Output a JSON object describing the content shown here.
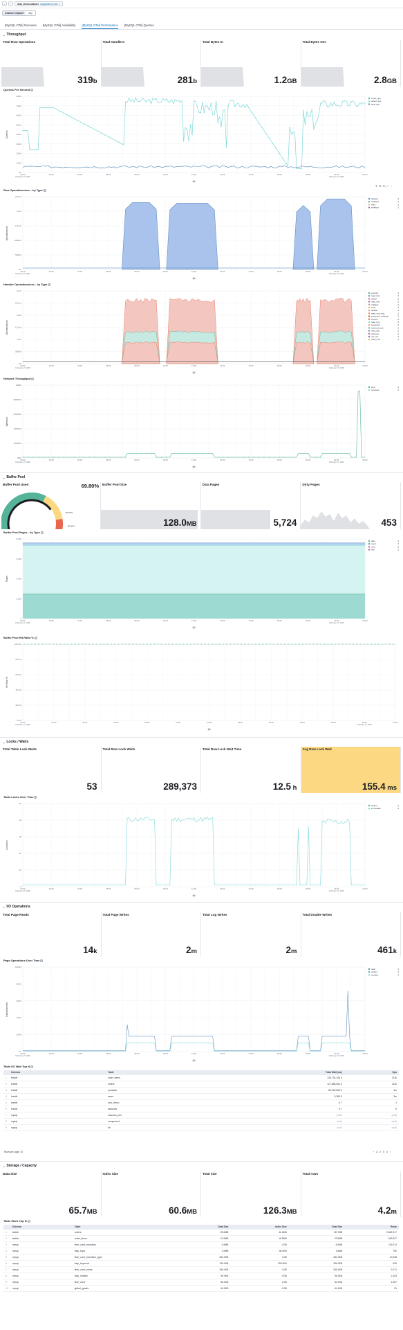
{
  "header": {
    "filter_key": "data_stream.dataset",
    "filter_val": "mysqlobserve.otel"
  },
  "filter": {
    "label": "instance.endpoint",
    "value": "Any"
  },
  "tabs": [
    "[MySQL OTel] Overview",
    "[MySQL OTel] Availability",
    "[MySQL OTel] Performance",
    "[MySQL OTel] Queries"
  ],
  "sections": {
    "throughput": "Throughput",
    "buffer": "Buffer Pool",
    "locks": "Locks / Waits",
    "io": "I/O Operations",
    "storage": "Storage / Capacity"
  },
  "throughput_tiles": [
    {
      "title": "Total Row Operations",
      "value": "319",
      "unit": "b"
    },
    {
      "title": "Total Handlers",
      "value": "281",
      "unit": "b"
    },
    {
      "title": "Total Bytes In",
      "value": "1.2",
      "unit": "GB"
    },
    {
      "title": "Total Bytes Out",
      "value": "2.8",
      "unit": "GB"
    }
  ],
  "panels": {
    "qps": {
      "title": "Queries Per Second",
      "ylabel": "Queries",
      "xlabel": "@t",
      "legend": [
        "insert_qps",
        "select_qps",
        "total_qps"
      ]
    },
    "rowops": {
      "title": "Row Operations/sec - by Type",
      "ylabel": "Operations/sec",
      "xlabel": "@t",
      "legend": [
        "deleted",
        "updated",
        "read",
        "inserted"
      ],
      "legend_vals": [
        "2",
        "2",
        "2",
        "2"
      ]
    },
    "handler": {
      "title": "Handler Operations/sec - by Type",
      "ylabel": "Operations/sec",
      "xlabel": "@t",
      "legend": [
        "prepare",
        "read_first",
        "delete",
        "read_first",
        "rollback",
        "write",
        "update",
        "read_rnd_next",
        "savepoint_rollback",
        "commit",
        "read_key",
        "savepoint",
        "external_lock",
        "read_last",
        "discover",
        "mrr_init",
        "read_next"
      ],
      "legend_vals": [
        "2",
        "2",
        "2",
        "2",
        "2",
        "2",
        "2",
        "2",
        "2",
        "2",
        "2",
        "2",
        "2",
        "2",
        "2",
        "2",
        "2"
      ]
    },
    "network": {
      "title": "Network Throughput",
      "ylabel": "Bytes/sec",
      "xlabel": "@t",
      "legend": [
        "sent",
        "received"
      ],
      "legend_vals": [
        "2",
        "2"
      ]
    },
    "bufpages": {
      "title": "Buffer Pool Pages - by Type",
      "ylabel": "Pages",
      "xlabel": "@t",
      "legend": [
        "data",
        "used",
        "misc",
        "free"
      ],
      "legend_vals": [
        "2",
        "2",
        "2",
        "2"
      ]
    },
    "hitratio": {
      "title": "Buffer Pool Hit Ratio %",
      "ylabel": "Hit Ratio %",
      "xlabel": "@t"
    },
    "tablelocks": {
      "title": "Table Locks Over Time",
      "ylabel": "Locks/sec",
      "xlabel": "@t",
      "legend": [
        "waited",
        "immediate"
      ],
      "legend_vals": [
        "2",
        "2"
      ]
    },
    "pageops": {
      "title": "Page Operations Over Time",
      "ylabel": "Operations/sec",
      "xlabel": "@t",
      "legend": [
        "read",
        "written",
        "created"
      ],
      "legend_vals": [
        "2",
        "2",
        "2"
      ]
    }
  },
  "date_label": "February 17, 2026",
  "buffer": {
    "gauge_title": "Buffer Pool Used",
    "gauge_value": "69.80%",
    "gauge_ticks": [
      "80.00%",
      "90.00%",
      "100.00%"
    ],
    "tiles": [
      {
        "title": "Buffer Pool Size",
        "value": "128.0",
        "unit": "MB"
      },
      {
        "title": "Data Pages",
        "value": "5,724",
        "unit": ""
      },
      {
        "title": "Dirty Pages",
        "value": "453",
        "unit": ""
      }
    ]
  },
  "locks_tiles": [
    {
      "title": "Total Table Lock Waits",
      "value": "53",
      "unit": ""
    },
    {
      "title": "Total Row Lock Waits",
      "value": "289,373",
      "unit": ""
    },
    {
      "title": "Total Row Lock Wait Time",
      "value": "12.5",
      "unit": " h"
    },
    {
      "title": "Avg Row Lock Wait",
      "value": "155.4",
      "unit": " ms"
    }
  ],
  "io_tiles": [
    {
      "title": "Total Page Reads",
      "value": "14",
      "unit": "k"
    },
    {
      "title": "Total Page Writes",
      "value": "2",
      "unit": "m"
    },
    {
      "title": "Total Log Writes",
      "value": "2",
      "unit": "m"
    },
    {
      "title": "Total Double Writes",
      "value": "461",
      "unit": "k"
    }
  ],
  "io_table": {
    "title": "Table I/O Wait Top N",
    "headers": [
      "Schema",
      "Table",
      "Total Wait (ms)",
      "Ops"
    ],
    "rows": [
      [
        "testdb",
        "order_items",
        "136,734,106.3",
        "113k"
      ],
      [
        "testdb",
        "orders",
        "127,868,561.4",
        "113k"
      ],
      [
        "testdb",
        "products",
        "65,220,803.0",
        "4m"
      ],
      [
        "testdb",
        "users",
        "5,383.9",
        "3m"
      ],
      [
        "testdb",
        "lock_demo",
        "0.7",
        "1"
      ],
      [
        "testdb",
        "sessions",
        "0.7",
        "9"
      ],
      [
        "mysql",
        "columns_priv",
        "(null)",
        "(null)"
      ],
      [
        "mysql",
        "component",
        "(null)",
        "(null)"
      ],
      [
        "mysql",
        "db",
        "(null)",
        "(null)"
      ]
    ],
    "footer": "Rows per page: 10",
    "pages": [
      "1",
      "2",
      "3",
      "4"
    ]
  },
  "storage_tiles": [
    {
      "title": "Data Size",
      "value": "65.7",
      "unit": "MB"
    },
    {
      "title": "Index Size",
      "value": "60.6",
      "unit": "MB"
    },
    {
      "title": "Total size",
      "value": "126.3",
      "unit": "MB"
    },
    {
      "title": "Total rows",
      "value": "4.2",
      "unit": "m"
    }
  ],
  "size_table": {
    "title": "Table Sizes Top N",
    "headers": [
      "Schema",
      "Table",
      "Data Size",
      "Index Size",
      "Total Size",
      "Rows"
    ],
    "rows": [
      [
        "testdb",
        "orders",
        "59.6MB",
        "44.1MB",
        "80.7MB",
        "2,862,317"
      ],
      [
        "testdb",
        "order_items",
        "21.5MB",
        "16.5MB",
        "37.8MB",
        "842,527"
      ],
      [
        "mysql",
        "time_zone_transition",
        "4.5MB",
        "0.0B",
        "4.5MB",
        "119,074"
      ],
      [
        "mysql",
        "help_topic",
        "1.5MB",
        "96.0KB",
        "1.6MB",
        "750"
      ],
      [
        "mysql",
        "time_zone_transition_type",
        "464.0KB",
        "0.0B",
        "464.0KB",
        "10,038"
      ],
      [
        "mysql",
        "help_keyword",
        "128.0KB",
        "128.0KB",
        "256.0KB",
        "939"
      ],
      [
        "mysql",
        "time_zone_name",
        "256.0KB",
        "0.0B",
        "256.0KB",
        "2,071"
      ],
      [
        "mysql",
        "help_relation",
        "96.0KB",
        "0.0B",
        "96.0KB",
        "2,153"
      ],
      [
        "mysql",
        "time_zone",
        "80.0KB",
        "0.0B",
        "80.0KB",
        "1,457"
      ],
      [
        "mysql",
        "global_grants",
        "64.0KB",
        "0.0B",
        "64.0KB",
        "51"
      ]
    ]
  },
  "colors": {
    "teal": "#54b399",
    "blue": "#6092c0",
    "pink": "#d36086",
    "amber": "#fcd883",
    "cyan": "#7fd8d8"
  }
}
